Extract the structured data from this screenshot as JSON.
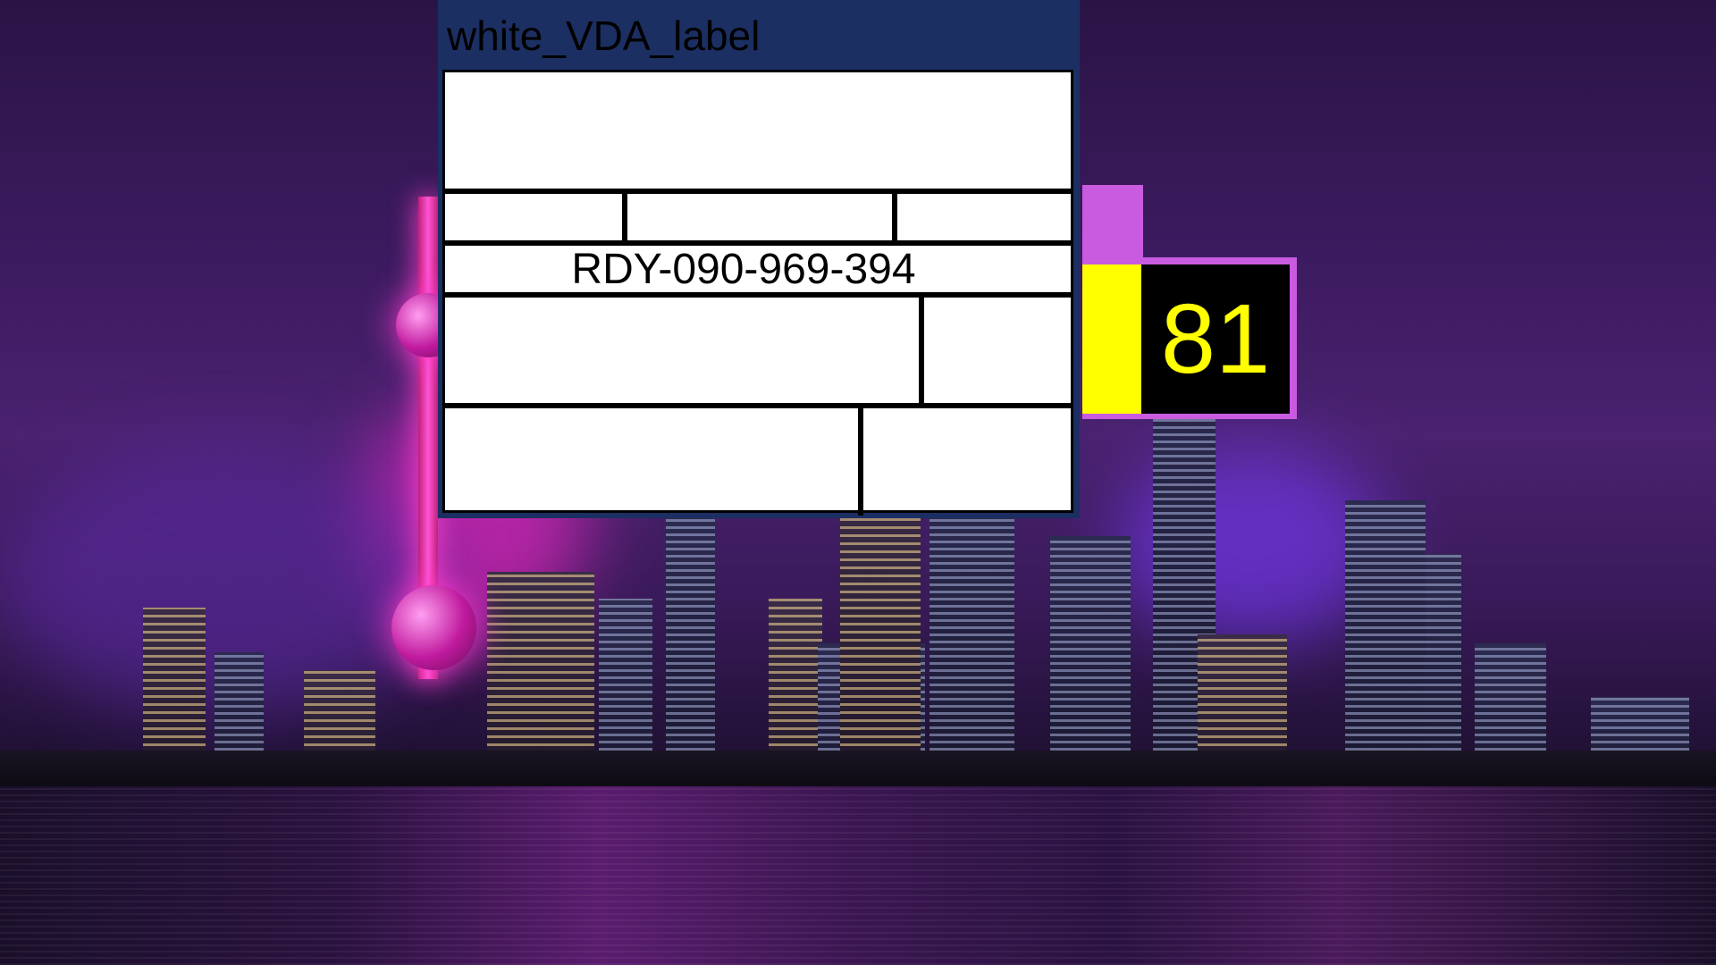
{
  "label_window": {
    "title": "white_VDA_label",
    "code": "RDY-090-969-394",
    "title_bar_color": "#1c2f63",
    "sheet_color": "#ffffff"
  },
  "badge": {
    "value": "81",
    "frame_color": "#c95be0",
    "swatch_color": "#ffff00",
    "number_color": "#ffff00",
    "number_background": "#000000"
  },
  "background": {
    "description_icon": "city-skyline-night-image"
  }
}
